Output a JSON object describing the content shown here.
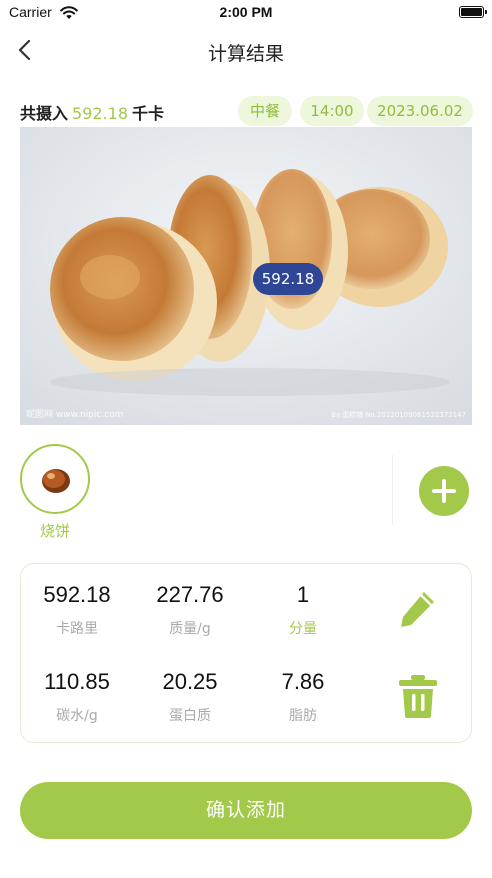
{
  "status_bar": {
    "carrier": "Carrier",
    "time": "2:00 PM"
  },
  "navbar": {
    "title": "计算结果"
  },
  "summary": {
    "intake_prefix": "共摄入",
    "intake_value": "592.18",
    "intake_unit": "千卡",
    "meal": "中餐",
    "time": "14:00",
    "date": "2023.06.02"
  },
  "photo": {
    "calorie_bubble": "592.18",
    "watermark_left": "昵图网 www.nipic.com",
    "watermark_right": "By:蛋糕铺 No.20120109081522372147"
  },
  "food_list": [
    {
      "name": "烧饼"
    }
  ],
  "nutrition": {
    "calories": {
      "value": "592.18",
      "label": "卡路里"
    },
    "weight": {
      "value": "227.76",
      "label": "质量/g"
    },
    "portion": {
      "value": "1",
      "label": "分量"
    },
    "carbs": {
      "value": "110.85",
      "label": "碳水/g"
    },
    "protein": {
      "value": "20.25",
      "label": "蛋白质"
    },
    "fat": {
      "value": "7.86",
      "label": "脂肪"
    }
  },
  "confirm_button": "确认添加",
  "colors": {
    "accent": "#a3c94a",
    "tag_bg": "#eef6dc",
    "bubble": "#2f4697"
  }
}
